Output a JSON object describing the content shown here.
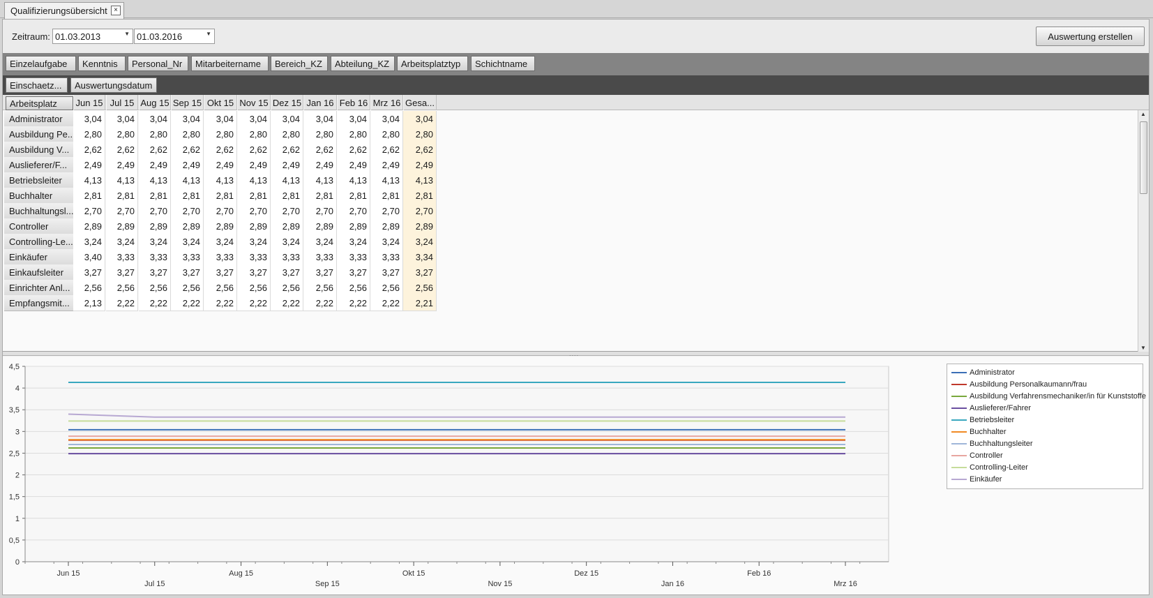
{
  "tab": {
    "title": "Qualifizierungsübersicht",
    "close_symbol": "×"
  },
  "toolbar": {
    "zeitraum_label": "Zeitraum:",
    "date_from": "01.03.2013",
    "date_to": "01.03.2016",
    "button_label": "Auswertung erstellen"
  },
  "filter_fields": [
    "Einzelaufgabe",
    "Kenntnis",
    "Personal_Nr",
    "Mitarbeitername",
    "Bereich_KZ",
    "Abteilung_KZ",
    "Arbeitsplatztyp",
    "Schichtname"
  ],
  "data_fields": [
    "Einschaetz...",
    "Auswertungsdatum"
  ],
  "row_field": "Arbeitsplatz",
  "grid": {
    "columns": [
      "Jun 15",
      "Jul 15",
      "Aug 15",
      "Sep 15",
      "Okt 15",
      "Nov 15",
      "Dez 15",
      "Jan 16",
      "Feb 16",
      "Mrz 16",
      "Gesa..."
    ],
    "rows": [
      {
        "label": "Administrator",
        "values": [
          "3,04",
          "3,04",
          "3,04",
          "3,04",
          "3,04",
          "3,04",
          "3,04",
          "3,04",
          "3,04",
          "3,04",
          "3,04"
        ]
      },
      {
        "label": "Ausbildung Pe...",
        "values": [
          "2,80",
          "2,80",
          "2,80",
          "2,80",
          "2,80",
          "2,80",
          "2,80",
          "2,80",
          "2,80",
          "2,80",
          "2,80"
        ]
      },
      {
        "label": "Ausbildung V...",
        "values": [
          "2,62",
          "2,62",
          "2,62",
          "2,62",
          "2,62",
          "2,62",
          "2,62",
          "2,62",
          "2,62",
          "2,62",
          "2,62"
        ]
      },
      {
        "label": "Auslieferer/F...",
        "values": [
          "2,49",
          "2,49",
          "2,49",
          "2,49",
          "2,49",
          "2,49",
          "2,49",
          "2,49",
          "2,49",
          "2,49",
          "2,49"
        ]
      },
      {
        "label": "Betriebsleiter",
        "values": [
          "4,13",
          "4,13",
          "4,13",
          "4,13",
          "4,13",
          "4,13",
          "4,13",
          "4,13",
          "4,13",
          "4,13",
          "4,13"
        ]
      },
      {
        "label": "Buchhalter",
        "values": [
          "2,81",
          "2,81",
          "2,81",
          "2,81",
          "2,81",
          "2,81",
          "2,81",
          "2,81",
          "2,81",
          "2,81",
          "2,81"
        ]
      },
      {
        "label": "Buchhaltungsl...",
        "values": [
          "2,70",
          "2,70",
          "2,70",
          "2,70",
          "2,70",
          "2,70",
          "2,70",
          "2,70",
          "2,70",
          "2,70",
          "2,70"
        ]
      },
      {
        "label": "Controller",
        "values": [
          "2,89",
          "2,89",
          "2,89",
          "2,89",
          "2,89",
          "2,89",
          "2,89",
          "2,89",
          "2,89",
          "2,89",
          "2,89"
        ]
      },
      {
        "label": "Controlling-Le...",
        "values": [
          "3,24",
          "3,24",
          "3,24",
          "3,24",
          "3,24",
          "3,24",
          "3,24",
          "3,24",
          "3,24",
          "3,24",
          "3,24"
        ]
      },
      {
        "label": "Einkäufer",
        "values": [
          "3,40",
          "3,33",
          "3,33",
          "3,33",
          "3,33",
          "3,33",
          "3,33",
          "3,33",
          "3,33",
          "3,33",
          "3,34"
        ]
      },
      {
        "label": "Einkaufsleiter",
        "values": [
          "3,27",
          "3,27",
          "3,27",
          "3,27",
          "3,27",
          "3,27",
          "3,27",
          "3,27",
          "3,27",
          "3,27",
          "3,27"
        ]
      },
      {
        "label": "Einrichter Anl...",
        "values": [
          "2,56",
          "2,56",
          "2,56",
          "2,56",
          "2,56",
          "2,56",
          "2,56",
          "2,56",
          "2,56",
          "2,56",
          "2,56"
        ]
      },
      {
        "label": "Empfangsmit...",
        "values": [
          "2,13",
          "2,22",
          "2,22",
          "2,22",
          "2,22",
          "2,22",
          "2,22",
          "2,22",
          "2,22",
          "2,22",
          "2,21"
        ]
      }
    ]
  },
  "chart_data": {
    "type": "line",
    "x": [
      "Jun 15",
      "Jul 15",
      "Aug 15",
      "Sep 15",
      "Okt 15",
      "Nov 15",
      "Dez 15",
      "Jan 16",
      "Feb 16",
      "Mrz 16"
    ],
    "yticks": [
      "0",
      "0,5",
      "1",
      "1,5",
      "2",
      "2,5",
      "3",
      "3,5",
      "4",
      "4,5"
    ],
    "ylim": [
      0,
      4.5
    ],
    "grid": true,
    "legend_position": "right",
    "series": [
      {
        "name": "Administrator",
        "color": "#3b6fb6",
        "values": [
          3.04,
          3.04,
          3.04,
          3.04,
          3.04,
          3.04,
          3.04,
          3.04,
          3.04,
          3.04
        ]
      },
      {
        "name": "Ausbildung Personalkaumann/frau",
        "color": "#c0392b",
        "values": [
          2.8,
          2.8,
          2.8,
          2.8,
          2.8,
          2.8,
          2.8,
          2.8,
          2.8,
          2.8
        ]
      },
      {
        "name": "Ausbildung Verfahrensmechaniker/in für Kunststoffe",
        "color": "#7aa83c",
        "values": [
          2.62,
          2.62,
          2.62,
          2.62,
          2.62,
          2.62,
          2.62,
          2.62,
          2.62,
          2.62
        ]
      },
      {
        "name": "Auslieferer/Fahrer",
        "color": "#6a4fa0",
        "values": [
          2.49,
          2.49,
          2.49,
          2.49,
          2.49,
          2.49,
          2.49,
          2.49,
          2.49,
          2.49
        ]
      },
      {
        "name": "Betriebsleiter",
        "color": "#3aa8bf",
        "values": [
          4.13,
          4.13,
          4.13,
          4.13,
          4.13,
          4.13,
          4.13,
          4.13,
          4.13,
          4.13
        ]
      },
      {
        "name": "Buchhalter",
        "color": "#f08a24",
        "values": [
          2.81,
          2.81,
          2.81,
          2.81,
          2.81,
          2.81,
          2.81,
          2.81,
          2.81,
          2.81
        ]
      },
      {
        "name": "Buchhaltungsleiter",
        "color": "#9fb6d9",
        "values": [
          2.7,
          2.7,
          2.7,
          2.7,
          2.7,
          2.7,
          2.7,
          2.7,
          2.7,
          2.7
        ]
      },
      {
        "name": "Controller",
        "color": "#e8a6a0",
        "values": [
          2.89,
          2.89,
          2.89,
          2.89,
          2.89,
          2.89,
          2.89,
          2.89,
          2.89,
          2.89
        ]
      },
      {
        "name": "Controlling-Leiter",
        "color": "#c6dc9a",
        "values": [
          3.24,
          3.24,
          3.24,
          3.24,
          3.24,
          3.24,
          3.24,
          3.24,
          3.24,
          3.24
        ]
      },
      {
        "name": "Einkäufer",
        "color": "#b7a8d2",
        "values": [
          3.4,
          3.33,
          3.33,
          3.33,
          3.33,
          3.33,
          3.33,
          3.33,
          3.33,
          3.33
        ]
      }
    ]
  }
}
